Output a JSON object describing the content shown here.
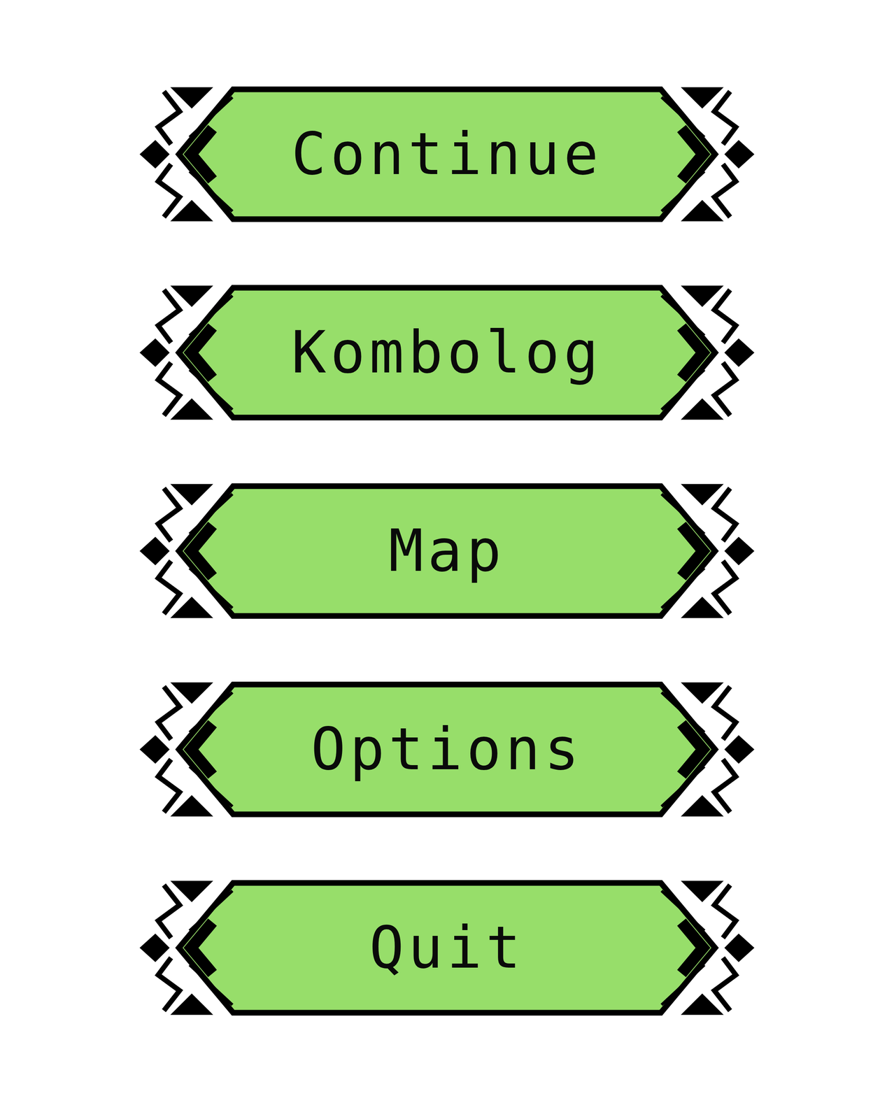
{
  "menu": {
    "buttons": [
      {
        "label": "Continue"
      },
      {
        "label": "Kombolog"
      },
      {
        "label": "Map"
      },
      {
        "label": "Options"
      },
      {
        "label": "Quit"
      }
    ]
  }
}
